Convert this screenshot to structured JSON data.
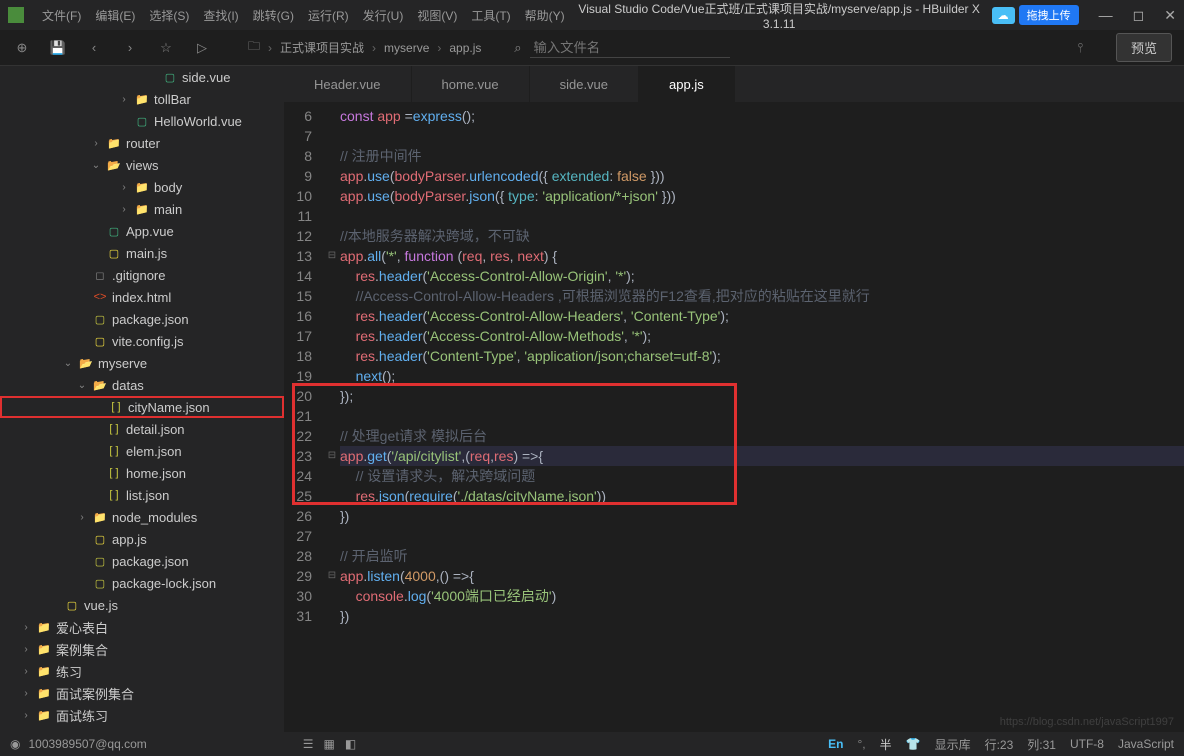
{
  "titlebar": {
    "menus": [
      "文件(F)",
      "编辑(E)",
      "选择(S)",
      "查找(I)",
      "跳转(G)",
      "运行(R)",
      "发行(U)",
      "视图(V)",
      "工具(T)",
      "帮助(Y)"
    ],
    "center_title": "Visual Studio Code/Vue正式班/正式课项目实战/myserve/app.js - HBuilder X 3.1.11",
    "version_badge": "",
    "switch_btn": "拖拽上传"
  },
  "toolbar": {
    "breadcrumb": [
      "正式课项目实战",
      "myserve",
      "app.js"
    ],
    "search_placeholder": "输入文件名",
    "preview": "预览"
  },
  "sidebar": {
    "items": [
      {
        "indent": 9,
        "icon": "file-vue",
        "iconText": "▢",
        "label": "side.vue"
      },
      {
        "indent": 7,
        "chev": "›",
        "icon": "folder",
        "iconText": "📁",
        "label": "tollBar"
      },
      {
        "indent": 7,
        "icon": "file-vue",
        "iconText": "▢",
        "label": "HelloWorld.vue"
      },
      {
        "indent": 5,
        "chev": "›",
        "icon": "folder",
        "iconText": "📁",
        "label": "router"
      },
      {
        "indent": 5,
        "chev": "⌄",
        "icon": "folder",
        "iconText": "📂",
        "label": "views"
      },
      {
        "indent": 7,
        "chev": "›",
        "icon": "folder",
        "iconText": "📁",
        "label": "body"
      },
      {
        "indent": 7,
        "chev": "›",
        "icon": "folder",
        "iconText": "📁",
        "label": "main"
      },
      {
        "indent": 5,
        "icon": "file-vue",
        "iconText": "▢",
        "label": "App.vue"
      },
      {
        "indent": 5,
        "icon": "file-js",
        "iconText": "▢",
        "label": "main.js"
      },
      {
        "indent": 4,
        "icon": "file-generic",
        "iconText": "◻",
        "label": ".gitignore"
      },
      {
        "indent": 4,
        "icon": "file-html",
        "iconText": "<>",
        "label": "index.html"
      },
      {
        "indent": 4,
        "icon": "file-json",
        "iconText": "▢",
        "label": "package.json"
      },
      {
        "indent": 4,
        "icon": "file-js",
        "iconText": "▢",
        "label": "vite.config.js"
      },
      {
        "indent": 3,
        "chev": "⌄",
        "icon": "folder",
        "iconText": "📂",
        "label": "myserve"
      },
      {
        "indent": 4,
        "chev": "⌄",
        "icon": "folder",
        "iconText": "📂",
        "label": "datas"
      },
      {
        "indent": 5,
        "icon": "file-json",
        "iconText": "[ ]",
        "label": "cityName.json",
        "highlighted": true
      },
      {
        "indent": 5,
        "icon": "file-json",
        "iconText": "[ ]",
        "label": "detail.json"
      },
      {
        "indent": 5,
        "icon": "file-json",
        "iconText": "[ ]",
        "label": "elem.json"
      },
      {
        "indent": 5,
        "icon": "file-json",
        "iconText": "[ ]",
        "label": "home.json"
      },
      {
        "indent": 5,
        "icon": "file-json",
        "iconText": "[ ]",
        "label": "list.json"
      },
      {
        "indent": 4,
        "chev": "›",
        "icon": "folder",
        "iconText": "📁",
        "label": "node_modules"
      },
      {
        "indent": 4,
        "icon": "file-js",
        "iconText": "▢",
        "label": "app.js"
      },
      {
        "indent": 4,
        "icon": "file-json",
        "iconText": "▢",
        "label": "package.json"
      },
      {
        "indent": 4,
        "icon": "file-json",
        "iconText": "▢",
        "label": "package-lock.json"
      },
      {
        "indent": 2,
        "icon": "file-js",
        "iconText": "▢",
        "label": "vue.js"
      },
      {
        "indent": 0,
        "chev": "›",
        "icon": "folder",
        "iconText": "📁",
        "label": "爱心表白"
      },
      {
        "indent": 0,
        "chev": "›",
        "icon": "folder",
        "iconText": "📁",
        "label": "案例集合"
      },
      {
        "indent": 0,
        "chev": "›",
        "icon": "folder",
        "iconText": "📁",
        "label": "练习"
      },
      {
        "indent": 0,
        "chev": "›",
        "icon": "folder",
        "iconText": "📁",
        "label": "面试案例集合"
      },
      {
        "indent": 0,
        "chev": "›",
        "icon": "folder",
        "iconText": "📁",
        "label": "面试练习"
      }
    ]
  },
  "tabs": [
    {
      "label": "Header.vue",
      "active": false
    },
    {
      "label": "home.vue",
      "active": false
    },
    {
      "label": "side.vue",
      "active": false
    },
    {
      "label": "app.js",
      "active": true
    }
  ],
  "code": {
    "lines": [
      {
        "num": 6,
        "fold": "",
        "html": "<span class='tok-kw'>const</span> <span class='tok-id'>app</span> <span class='tok-plain'>=</span><span class='tok-fn'>express</span><span class='tok-plain'>();</span>"
      },
      {
        "num": 7,
        "fold": "",
        "html": ""
      },
      {
        "num": 8,
        "fold": "",
        "html": "<span class='tok-comment'>// 注册中间件</span>"
      },
      {
        "num": 9,
        "fold": "",
        "html": "<span class='tok-id'>app</span><span class='tok-plain'>.</span><span class='tok-fn'>use</span><span class='tok-plain'>(</span><span class='tok-id'>bodyParser</span><span class='tok-plain'>.</span><span class='tok-fn'>urlencoded</span><span class='tok-plain'>({ </span><span class='tok-prop'>extended</span><span class='tok-plain'>: </span><span class='tok-const'>false</span><span class='tok-plain'> }))</span>"
      },
      {
        "num": 10,
        "fold": "",
        "html": "<span class='tok-id'>app</span><span class='tok-plain'>.</span><span class='tok-fn'>use</span><span class='tok-plain'>(</span><span class='tok-id'>bodyParser</span><span class='tok-plain'>.</span><span class='tok-fn'>json</span><span class='tok-plain'>({ </span><span class='tok-prop'>type</span><span class='tok-plain'>: </span><span class='tok-str'>'application/*+json'</span><span class='tok-plain'> }))</span>"
      },
      {
        "num": 11,
        "fold": "",
        "html": ""
      },
      {
        "num": 12,
        "fold": "",
        "html": "<span class='tok-comment'>//本地服务器解决跨域，不可缺</span>"
      },
      {
        "num": 13,
        "fold": "⊟",
        "html": "<span class='tok-id'>app</span><span class='tok-plain'>.</span><span class='tok-fn'>all</span><span class='tok-plain'>(</span><span class='tok-str'>'*'</span><span class='tok-plain'>, </span><span class='tok-kw'>function</span><span class='tok-plain'> (</span><span class='tok-id'>req</span><span class='tok-plain'>, </span><span class='tok-id'>res</span><span class='tok-plain'>, </span><span class='tok-id'>next</span><span class='tok-plain'>) {</span>"
      },
      {
        "num": 14,
        "fold": "",
        "html": "    <span class='tok-id'>res</span><span class='tok-plain'>.</span><span class='tok-fn'>header</span><span class='tok-plain'>(</span><span class='tok-str'>'Access-Control-Allow-Origin'</span><span class='tok-plain'>, </span><span class='tok-str'>'*'</span><span class='tok-plain'>);</span>"
      },
      {
        "num": 15,
        "fold": "",
        "html": "    <span class='tok-comment'>//Access-Control-Allow-Headers ,可根据浏览器的F12查看,把对应的粘贴在这里就行</span>"
      },
      {
        "num": 16,
        "fold": "",
        "html": "    <span class='tok-id'>res</span><span class='tok-plain'>.</span><span class='tok-fn'>header</span><span class='tok-plain'>(</span><span class='tok-str'>'Access-Control-Allow-Headers'</span><span class='tok-plain'>, </span><span class='tok-str'>'Content-Type'</span><span class='tok-plain'>);</span>"
      },
      {
        "num": 17,
        "fold": "",
        "html": "    <span class='tok-id'>res</span><span class='tok-plain'>.</span><span class='tok-fn'>header</span><span class='tok-plain'>(</span><span class='tok-str'>'Access-Control-Allow-Methods'</span><span class='tok-plain'>, </span><span class='tok-str'>'*'</span><span class='tok-plain'>);</span>"
      },
      {
        "num": 18,
        "fold": "",
        "html": "    <span class='tok-id'>res</span><span class='tok-plain'>.</span><span class='tok-fn'>header</span><span class='tok-plain'>(</span><span class='tok-str'>'Content-Type'</span><span class='tok-plain'>, </span><span class='tok-str'>'application/json;charset=utf-8'</span><span class='tok-plain'>);</span>"
      },
      {
        "num": 19,
        "fold": "",
        "html": "    <span class='tok-fn'>next</span><span class='tok-plain'>();</span>"
      },
      {
        "num": 20,
        "fold": "",
        "html": "<span class='tok-plain'>});</span>"
      },
      {
        "num": 21,
        "fold": "",
        "html": ""
      },
      {
        "num": 22,
        "fold": "",
        "html": "<span class='tok-comment'>// 处理get请求 模拟后台</span>"
      },
      {
        "num": 23,
        "fold": "⊟",
        "html": "<span class='tok-id'>app</span><span class='tok-plain'>.</span><span class='tok-fn'>get</span><span class='tok-plain'>(</span><span class='tok-str'>'/api/citylist'</span><span class='tok-plain'>,(</span><span class='tok-id'>req</span><span class='tok-plain'>,</span><span class='tok-id'>res</span><span class='tok-plain'>) =>{</span>",
        "current": true
      },
      {
        "num": 24,
        "fold": "",
        "html": "    <span class='tok-comment'>// 设置请求头，解决跨域问题</span>"
      },
      {
        "num": 25,
        "fold": "",
        "html": "    <span class='tok-id'>res</span><span class='tok-plain'>.</span><span class='tok-fn'>json</span><span class='tok-plain'>(</span><span class='tok-fn'>require</span><span class='tok-plain'>(</span><span class='tok-str'>'./datas/cityName.json'</span><span class='tok-plain'>))</span>"
      },
      {
        "num": 26,
        "fold": "",
        "html": "<span class='tok-plain'>})</span>"
      },
      {
        "num": 27,
        "fold": "",
        "html": ""
      },
      {
        "num": 28,
        "fold": "",
        "html": "<span class='tok-comment'>// 开启监听</span>"
      },
      {
        "num": 29,
        "fold": "⊟",
        "html": "<span class='tok-id'>app</span><span class='tok-plain'>.</span><span class='tok-fn'>listen</span><span class='tok-plain'>(</span><span class='tok-num'>4000</span><span class='tok-plain'>,() =>{</span>"
      },
      {
        "num": 30,
        "fold": "",
        "html": "    <span class='tok-id'>console</span><span class='tok-plain'>.</span><span class='tok-fn'>log</span><span class='tok-plain'>(</span><span class='tok-str'>'4000端口已经启动'</span><span class='tok-plain'>)</span>"
      },
      {
        "num": 31,
        "fold": "",
        "html": "<span class='tok-plain'>})</span>"
      }
    ]
  },
  "statusbar": {
    "user": "1003989507@qq.com",
    "lang_badge": "En",
    "lib": "显示库",
    "line": "行:23",
    "col": "列:31",
    "encoding": "UTF-8",
    "filetype": "JavaScript"
  },
  "watermark": "https://blog.csdn.net/javaScript1997",
  "colors": {
    "accent": "#49bef6",
    "highlight_border": "#e03030"
  }
}
